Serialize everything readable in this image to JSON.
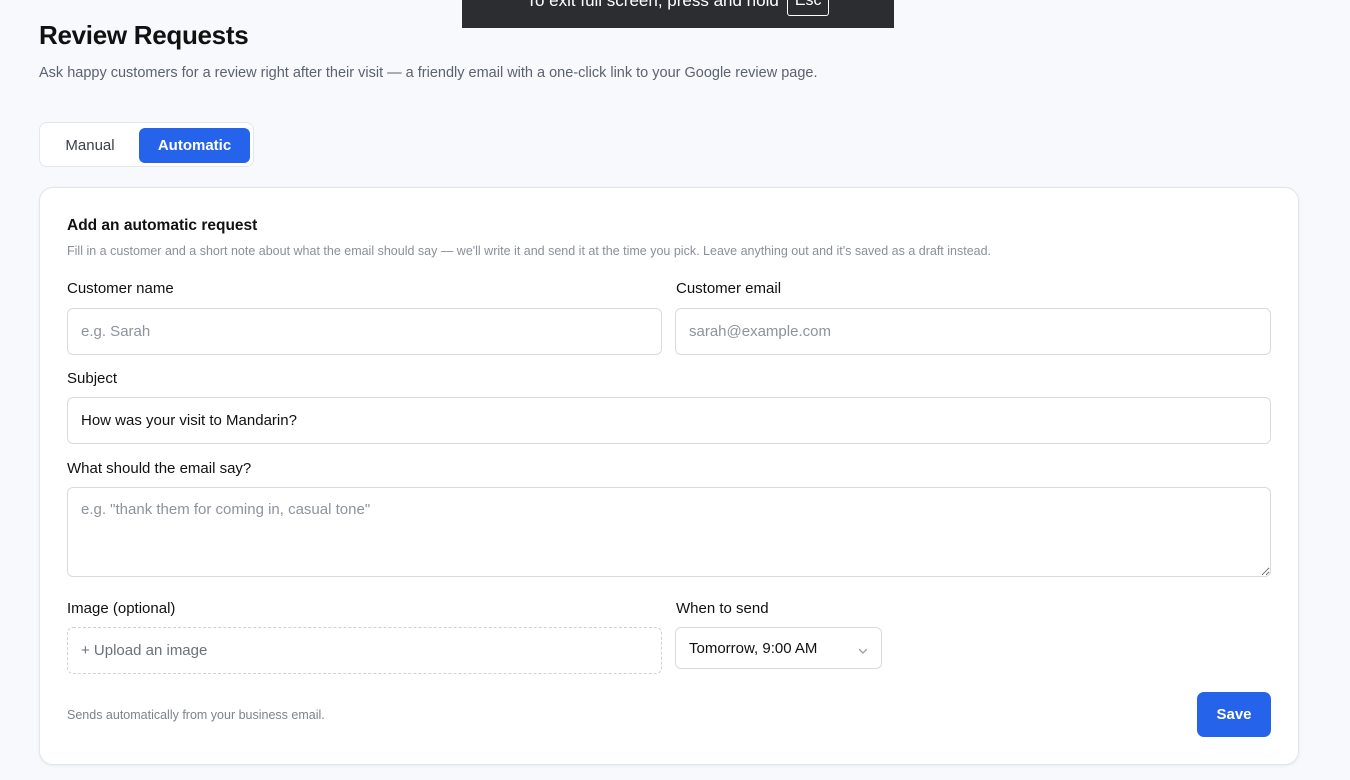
{
  "fullscreen_notice": {
    "text": "To exit full screen, press and hold",
    "key": "Esc"
  },
  "page": {
    "title": "Review Requests",
    "subtitle": "Ask happy customers for a review right after their visit — a friendly email with a one-click link to your Google review page."
  },
  "mode_toggle": {
    "manual_label": "Manual",
    "automatic_label": "Automatic",
    "selected": "Automatic"
  },
  "form": {
    "title": "Add an automatic request",
    "help": "Fill in a customer and a short note about what the email should say — we'll write it and send it at the time you pick. Leave anything out and it's saved as a draft instead.",
    "customer_name": {
      "label": "Customer name",
      "placeholder": "e.g. Sarah",
      "value": ""
    },
    "customer_email": {
      "label": "Customer email",
      "placeholder": "sarah@example.com",
      "value": ""
    },
    "subject": {
      "label": "Subject",
      "value": "How was your visit to Mandarin?"
    },
    "email_body": {
      "label": "What should the email say?",
      "placeholder": "e.g. \"thank them for coming in, casual tone\"",
      "value": ""
    },
    "image": {
      "label": "Image (optional)",
      "upload_label": "+ Upload an image"
    },
    "send_time": {
      "label": "When to send",
      "selected": "Tomorrow, 9:00 AM",
      "icon": "chevron-down-icon"
    },
    "footer_note": "Sends automatically from your business email.",
    "save_label": "Save"
  },
  "colors": {
    "accent": "#2563eb",
    "background": "#f7f9fc",
    "card": "#ffffff",
    "border": "#d7dbe1"
  }
}
